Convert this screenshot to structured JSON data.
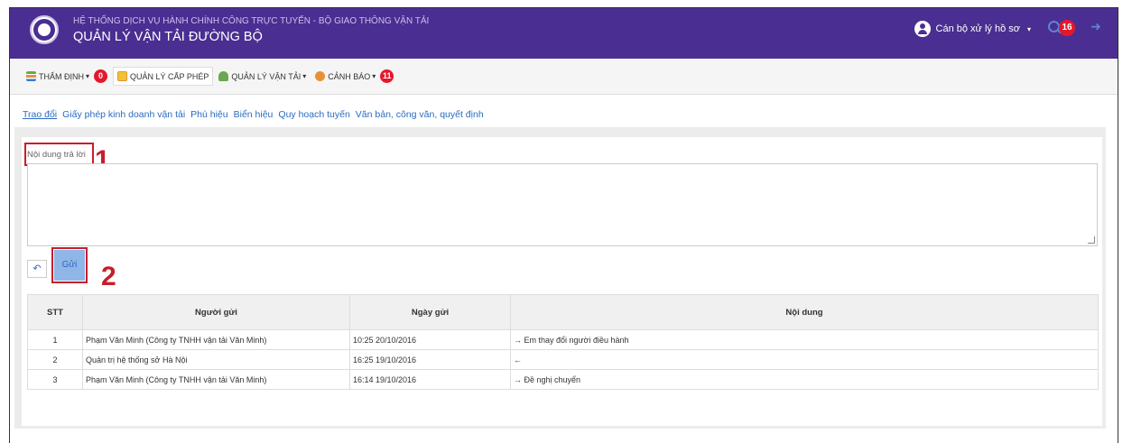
{
  "header": {
    "system_title": "HỆ THỐNG DỊCH VỤ HÀNH CHÍNH CÔNG TRỰC TUYẾN - BỘ GIAO THÔNG VẬN TẢI",
    "app_title": "QUẢN LÝ VẬN TẢI ĐƯỜNG BỘ",
    "user_label": "Cán bộ xử lý hồ sơ",
    "notification_count": "16"
  },
  "menu": {
    "items": [
      {
        "label": "THẨM ĐỊNH",
        "badge": "0",
        "icon": "list-icon"
      },
      {
        "label": "QUẢN LÝ CẤP PHÉP",
        "icon": "license-icon"
      },
      {
        "label": "QUẢN LÝ VẬN TẢI",
        "icon": "transport-icon"
      },
      {
        "label": "CẢNH BÁO",
        "badge": "11",
        "icon": "warning-icon"
      }
    ]
  },
  "tabs": [
    "Trao đổi",
    "Giấy phép kinh doanh vận tải",
    "Phù hiệu",
    "Biển hiệu",
    "Quy hoạch tuyến",
    "Văn bản, công văn, quyết định"
  ],
  "form": {
    "reply_label": "Nội dung trả lời",
    "send_label": "Gửi",
    "annotation_1": "1",
    "annotation_2": "2"
  },
  "table": {
    "headers": [
      "STT",
      "Người gửi",
      "Ngày gửi",
      "Nội dung"
    ],
    "rows": [
      {
        "stt": "1",
        "sender": "Phạm Văn Minh (Công ty TNHH vận tải Văn Minh)",
        "date": "10:25 20/10/2016",
        "content": "→ Em thay đổi người điều hành"
      },
      {
        "stt": "2",
        "sender": "Quản trị hệ thống sở Hà Nội",
        "date": "16:25 19/10/2016",
        "content": "←"
      },
      {
        "stt": "3",
        "sender": "Phạm Văn Minh (Công ty TNHH vận tải Văn Minh)",
        "date": "16:14 19/10/2016",
        "content": "→ Đề nghị chuyển"
      }
    ]
  }
}
